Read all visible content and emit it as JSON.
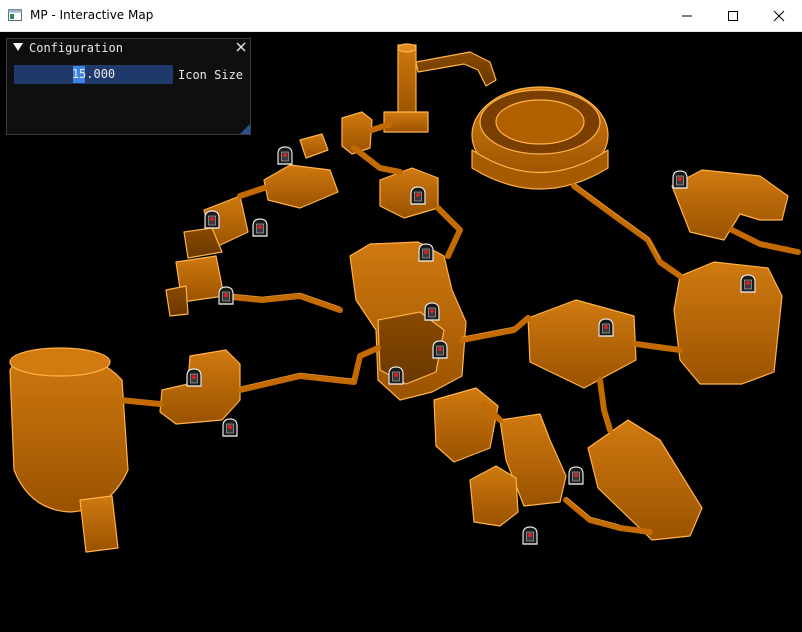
{
  "window": {
    "title": "MP - Interactive Map",
    "controls": [
      "minimize",
      "maximize",
      "close"
    ]
  },
  "config_panel": {
    "title": "Configuration",
    "slider_value": "15.000",
    "slider_fraction": 0.4,
    "slider_label": "Icon Size"
  },
  "map": {
    "wall_color": "#c36a00",
    "edge_color": "#ffb347",
    "icon_name": "robot-marker-icon",
    "icon_count": 17
  }
}
